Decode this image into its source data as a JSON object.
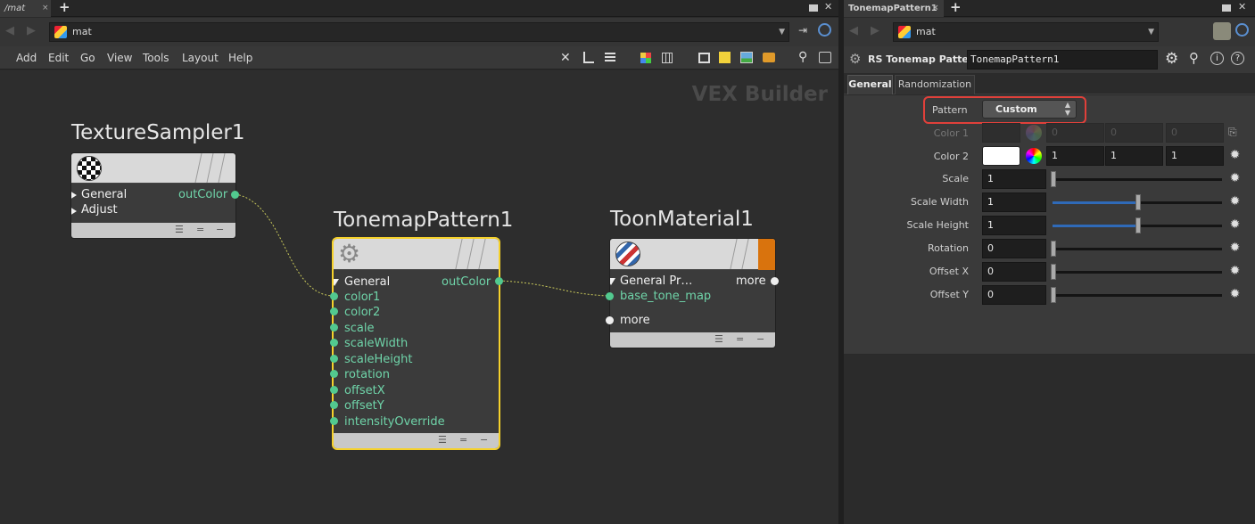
{
  "left_pane": {
    "tab_label": "/mat",
    "path": "mat",
    "menus": [
      "Add",
      "Edit",
      "Go",
      "View",
      "Tools",
      "Layout",
      "Help"
    ],
    "context_label": "VEX Builder"
  },
  "nodes": {
    "texture_sampler": {
      "title": "TextureSampler1",
      "inputs": [
        "General",
        "Adjust"
      ],
      "output": "outColor"
    },
    "tonemap_pattern": {
      "title": "TonemapPattern1",
      "group": "General",
      "output": "outColor",
      "inputs": [
        "color1",
        "color2",
        "scale",
        "scaleWidth",
        "scaleHeight",
        "rotation",
        "offsetX",
        "offsetY",
        "intensityOverride"
      ]
    },
    "toon_material": {
      "title": "ToonMaterial1",
      "group": "General Pr…",
      "more_right": "more",
      "input": "base_tone_map",
      "more_bottom": "more"
    }
  },
  "right_pane": {
    "tab_label": "TonemapPattern1",
    "path": "mat",
    "node_type": "RS Tonemap Pattern",
    "node_name": "TonemapPattern1",
    "tabs": [
      "General",
      "Randomization"
    ],
    "pattern": {
      "label": "Pattern",
      "value": "Custom"
    },
    "color1": {
      "label": "Color 1",
      "values": [
        "0",
        "0",
        "0"
      ]
    },
    "color2": {
      "label": "Color 2",
      "values": [
        "1",
        "1",
        "1"
      ]
    },
    "sliders": [
      {
        "label": "Scale",
        "value": "1",
        "fill": 0.0
      },
      {
        "label": "Scale Width",
        "value": "1",
        "fill": 0.5
      },
      {
        "label": "Scale Height",
        "value": "1",
        "fill": 0.5
      },
      {
        "label": "Rotation",
        "value": "0",
        "fill": 0.0
      },
      {
        "label": "Offset X",
        "value": "0",
        "fill": 0.0
      },
      {
        "label": "Offset Y",
        "value": "0",
        "fill": 0.0
      }
    ]
  },
  "colors": {
    "port_green": "#52c98f",
    "selection_yellow": "#f5d12b",
    "highlight_red": "#e0403a",
    "toon_accent": "#d9730d"
  }
}
